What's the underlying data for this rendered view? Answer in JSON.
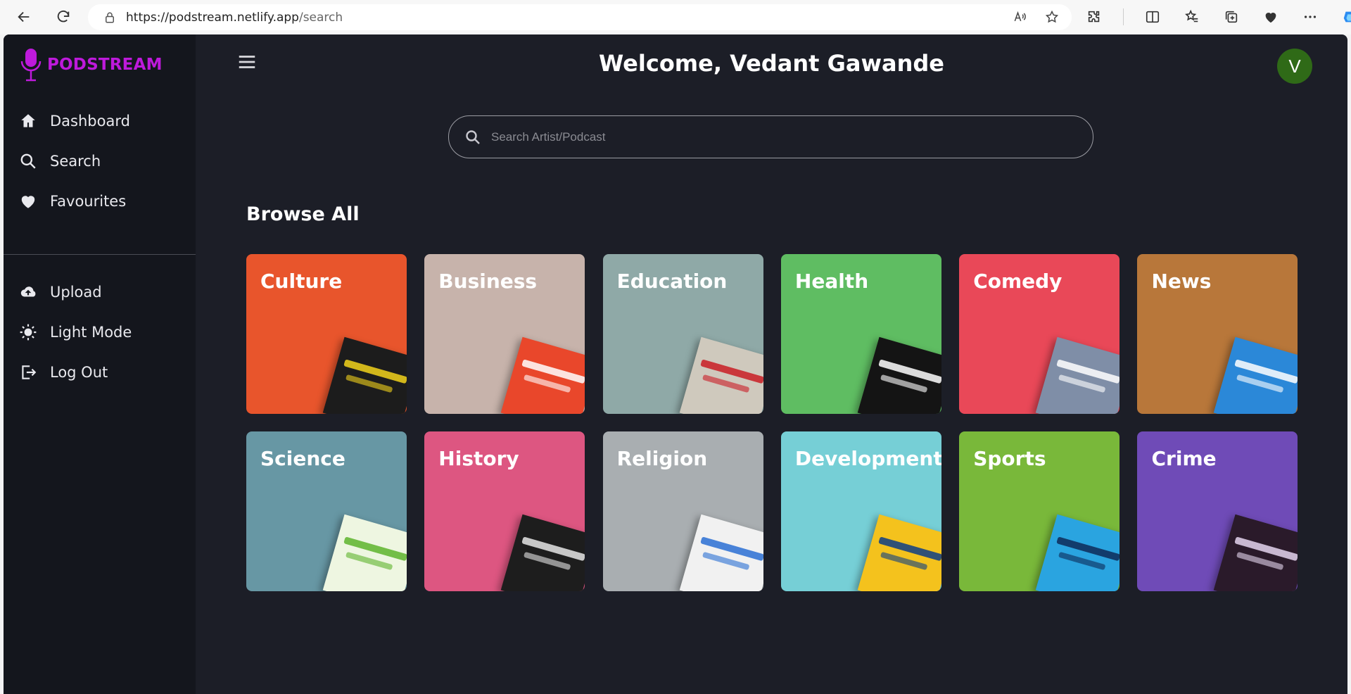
{
  "browser": {
    "url_host": "https://podstream.netlify.app",
    "url_path": "/search"
  },
  "app": {
    "logo_text": "PODSTREAM",
    "welcome": "Welcome, Vedant Gawande",
    "avatar_initial": "V"
  },
  "sidebar": {
    "items": [
      {
        "label": "Dashboard",
        "icon": "home-icon"
      },
      {
        "label": "Search",
        "icon": "search-icon"
      },
      {
        "label": "Favourites",
        "icon": "heart-icon"
      },
      {
        "label": "Upload",
        "icon": "cloud-upload-icon"
      },
      {
        "label": "Light Mode",
        "icon": "sun-icon"
      },
      {
        "label": "Log Out",
        "icon": "logout-icon"
      }
    ]
  },
  "search": {
    "placeholder": "Search Artist/Podcast"
  },
  "browse": {
    "title": "Browse All",
    "categories": [
      {
        "name": "Culture",
        "color": "#e8552c",
        "art_color": "#1c1c1c",
        "art_text_color": "#f2d21b"
      },
      {
        "name": "Business",
        "color": "#c7b3ab",
        "art_color": "#e9472b",
        "art_text_color": "#ffffff"
      },
      {
        "name": "Education",
        "color": "#8fa9a7",
        "art_color": "#cfc9bd",
        "art_text_color": "#c91d25"
      },
      {
        "name": "Health",
        "color": "#5fbd62",
        "art_color": "#141414",
        "art_text_color": "#ffffff"
      },
      {
        "name": "Comedy",
        "color": "#e94858",
        "art_color": "#7f8ea7",
        "art_text_color": "#ffffff"
      },
      {
        "name": "News",
        "color": "#b8773a",
        "art_color": "#2b88d8",
        "art_text_color": "#ffffff"
      },
      {
        "name": "Science",
        "color": "#6797a4",
        "art_color": "#eef6e1",
        "art_text_color": "#5db42b"
      },
      {
        "name": "History",
        "color": "#dd5681",
        "art_color": "#1d1d1d",
        "art_text_color": "#e5e5e5"
      },
      {
        "name": "Religion",
        "color": "#a9aeb1",
        "art_color": "#f1f1f1",
        "art_text_color": "#2a6fd3"
      },
      {
        "name": "Development",
        "color": "#76cfd6",
        "art_color": "#f4c21d",
        "art_text_color": "#0d3d86"
      },
      {
        "name": "Sports",
        "color": "#79b83a",
        "art_color": "#2aa4e0",
        "art_text_color": "#0e2a57"
      },
      {
        "name": "Crime",
        "color": "#6f4bb7",
        "art_color": "#2a1a2a",
        "art_text_color": "#e4d5ef"
      }
    ]
  }
}
